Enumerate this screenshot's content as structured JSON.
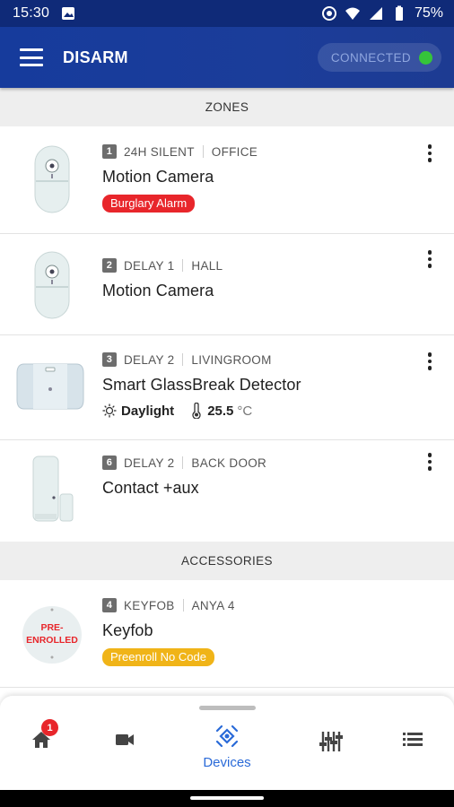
{
  "status_bar": {
    "time": "15:30",
    "battery": "75%"
  },
  "app_bar": {
    "title": "DISARM",
    "connection_label": "CONNECTED",
    "connection_color": "#35c43a"
  },
  "sections": {
    "zones": "ZONES",
    "accessories": "ACCESSORIES"
  },
  "zones": [
    {
      "num": "1",
      "type": "24H SILENT",
      "room": "OFFICE",
      "name": "Motion Camera",
      "badge": "Burglary Alarm"
    },
    {
      "num": "2",
      "type": "DELAY 1",
      "room": "HALL",
      "name": "Motion Camera"
    },
    {
      "num": "3",
      "type": "DELAY 2",
      "room": "LIVINGROOM",
      "name": "Smart GlassBreak Detector",
      "light": "Daylight",
      "temp": "25.5",
      "temp_unit": "°C"
    },
    {
      "num": "6",
      "type": "DELAY 2",
      "room": "BACK DOOR",
      "name": "Contact +aux"
    }
  ],
  "accessories": [
    {
      "num": "4",
      "type": "KEYFOB",
      "room": "ANYA 4",
      "name": "Keyfob",
      "badge": "Preenroll No Code",
      "thumb_text": "PRE-\nENROLLED"
    }
  ],
  "bottom_nav": {
    "home_badge": "1",
    "active_label": "Devices",
    "items": [
      "home-icon",
      "camera-icon",
      "devices-icon",
      "equalizer-icon",
      "list-icon"
    ]
  },
  "colors": {
    "primary": "#163b9c",
    "accent": "#2a6ad8",
    "alarm": "#e8262b",
    "warning": "#f0b418"
  }
}
